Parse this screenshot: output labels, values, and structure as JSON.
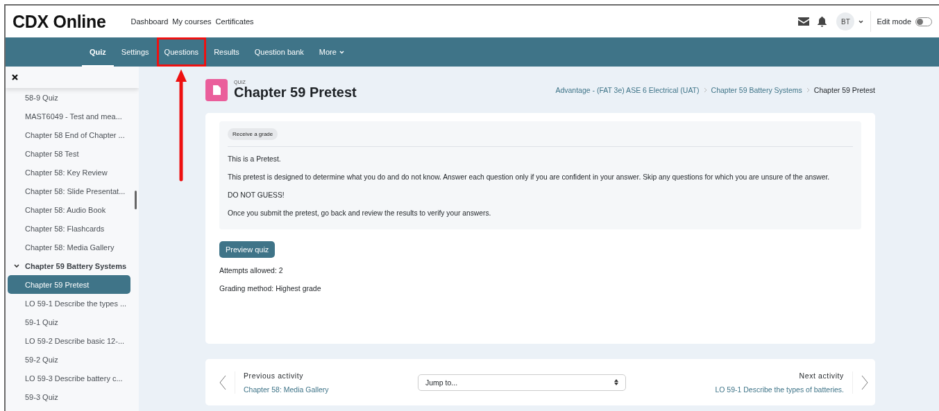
{
  "header": {
    "logo": "CDX Online",
    "links": [
      "Dashboard",
      "My courses",
      "Certificates"
    ],
    "avatar": "BT",
    "edit_mode": {
      "label": "Edit mode",
      "on": false
    }
  },
  "nav": {
    "tabs": [
      {
        "label": "Quiz",
        "selected": true,
        "annotated": false,
        "kind": "tab"
      },
      {
        "label": "Settings",
        "selected": false,
        "annotated": false,
        "kind": "tab"
      },
      {
        "label": "Questions",
        "selected": false,
        "annotated": true,
        "kind": "tab"
      },
      {
        "label": "Results",
        "selected": false,
        "annotated": false,
        "kind": "tab"
      },
      {
        "label": "Question bank",
        "selected": false,
        "annotated": false,
        "kind": "tab"
      },
      {
        "label": "More",
        "selected": false,
        "annotated": false,
        "kind": "menu"
      }
    ]
  },
  "sidebar": {
    "items": [
      {
        "label": "58-9 Quiz",
        "kind": "item",
        "selected": false
      },
      {
        "label": "MAST6049 - Test and mea...",
        "kind": "item",
        "selected": false
      },
      {
        "label": "Chapter 58 End of Chapter ...",
        "kind": "item",
        "selected": false
      },
      {
        "label": "Chapter 58 Test",
        "kind": "item",
        "selected": false
      },
      {
        "label": "Chapter 58: Key Review",
        "kind": "item",
        "selected": false
      },
      {
        "label": "Chapter 58: Slide Presentat...",
        "kind": "item",
        "selected": false
      },
      {
        "label": "Chapter 58: Audio Book",
        "kind": "item",
        "selected": false
      },
      {
        "label": "Chapter 58: Flashcards",
        "kind": "item",
        "selected": false
      },
      {
        "label": "Chapter 58: Media Gallery",
        "kind": "item",
        "selected": false
      },
      {
        "label": "Chapter 59 Battery Systems",
        "kind": "section",
        "expanded": true,
        "selected": false
      },
      {
        "label": "Chapter 59 Pretest",
        "kind": "item",
        "selected": true
      },
      {
        "label": "LO 59-1 Describe the types ...",
        "kind": "item",
        "selected": false
      },
      {
        "label": "59-1 Quiz",
        "kind": "item",
        "selected": false
      },
      {
        "label": "LO 59-2 Describe basic 12-...",
        "kind": "item",
        "selected": false
      },
      {
        "label": "59-2 Quiz",
        "kind": "item",
        "selected": false
      },
      {
        "label": "LO 59-3 Describe battery c...",
        "kind": "item",
        "selected": false
      },
      {
        "label": "59-3 Quiz",
        "kind": "item",
        "selected": false
      }
    ]
  },
  "page": {
    "label": "QUIZ",
    "title": "Chapter 59 Pretest",
    "breadcrumb": [
      "Advantage - (FAT 3e) ASE 6 Electrical (UAT)",
      "Chapter 59 Battery Systems",
      "Chapter 59 Pretest"
    ]
  },
  "card": {
    "badge": "Receive a grade",
    "paragraphs": [
      "This is a Pretest.",
      "This pretest is designed to determine what you do and do not know. Answer each question only if you are confident in your answer. Skip any questions for which you are unsure of the answer.",
      "DO NOT GUESS!",
      "Once you submit the pretest, go back and review the results to verify your answers."
    ],
    "button": "Preview quiz",
    "info": [
      "Attempts allowed: 2",
      "Grading method: Highest grade"
    ]
  },
  "activity_nav": {
    "previous": {
      "heading": "Previous activity",
      "link": "Chapter 58: Media Gallery"
    },
    "jump": {
      "value": "Jump to..."
    },
    "next": {
      "heading": "Next activity",
      "link": "LO 59-1 Describe the types of batteries."
    }
  }
}
